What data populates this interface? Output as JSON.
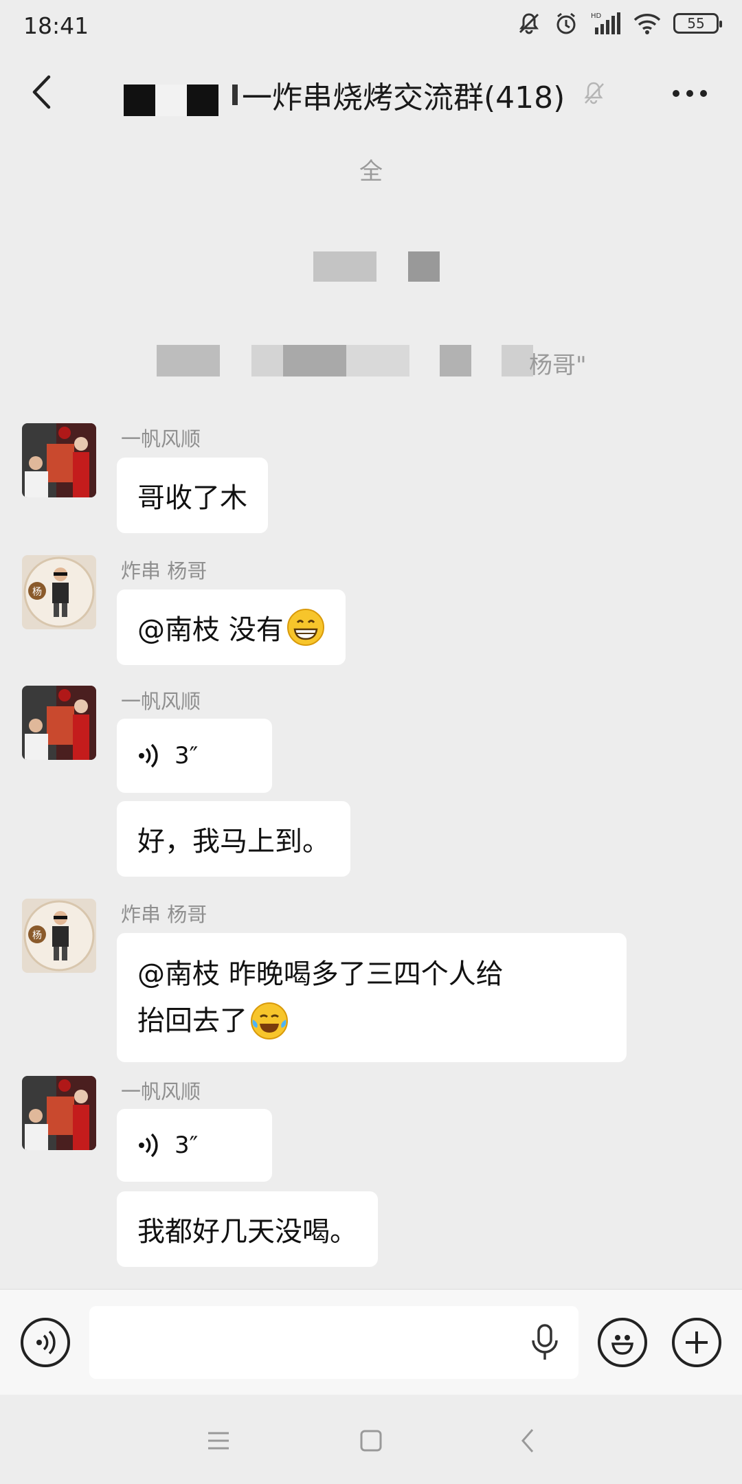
{
  "status_bar": {
    "time": "18:41",
    "battery": "55"
  },
  "header": {
    "title": "一炸串烧烤交流群(418)"
  },
  "system_messages": {
    "line1": "全",
    "line3_suffix": "杨哥\""
  },
  "messages": [
    {
      "sender": "一帆风顺",
      "type": "text",
      "text": "哥收了木"
    },
    {
      "sender": "炸串  杨哥",
      "type": "text",
      "text": "@南枝   没有",
      "emoji": "grinning-face"
    },
    {
      "sender": "一帆风顺",
      "type": "voice",
      "duration": "3″"
    },
    {
      "type": "text",
      "text": "好，我马上到。"
    },
    {
      "sender": "炸串  杨哥",
      "type": "text",
      "line1": "@南枝     昨晚喝多了三四个人给",
      "line2": "抬回去了",
      "emoji": "tears-of-joy-face"
    },
    {
      "sender": "一帆风顺",
      "type": "voice",
      "duration": "3″"
    },
    {
      "type": "text",
      "text": "我都好几天没喝。"
    }
  ],
  "input_bar": {
    "placeholder": ""
  },
  "colors": {
    "background": "#ededed",
    "bubble": "#ffffff",
    "meta_text": "#8f8f8f"
  }
}
